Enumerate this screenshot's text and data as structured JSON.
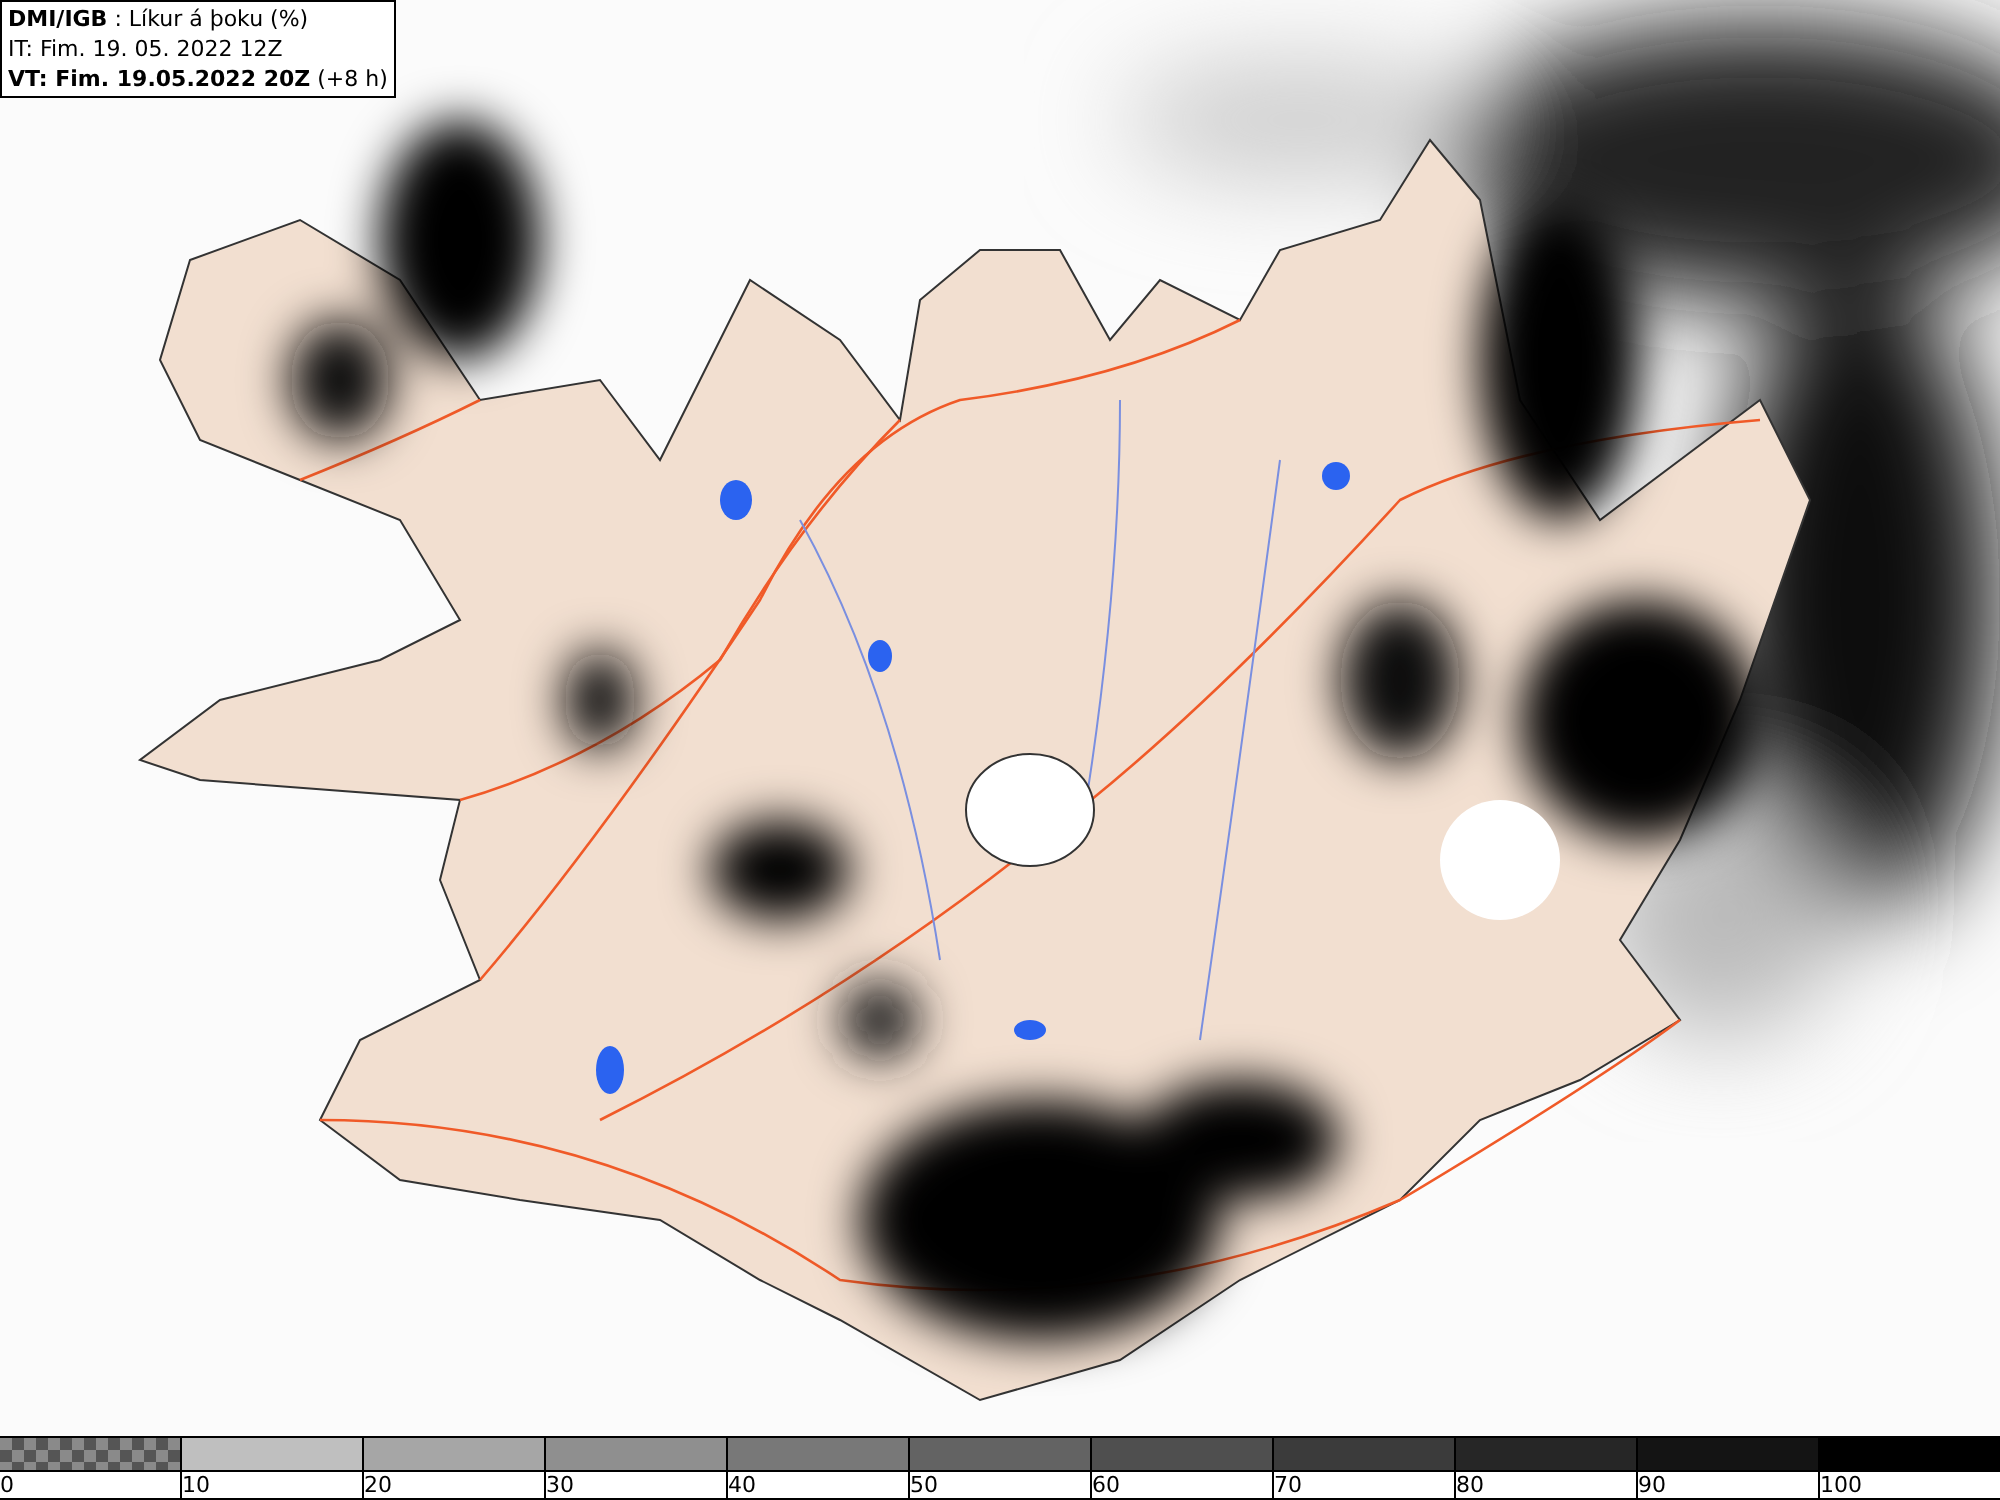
{
  "header": {
    "title": "**DMI/IGB** : Líkur á þoku (%)",
    "init_time": "IT: Fim. 19. 05. 2022 12Z",
    "valid_time": "**VT: Fim. 19.05.2022 20Z** (+8 h)"
  },
  "legend": [
    {
      "kind": "pattern",
      "label": "0"
    },
    {
      "kind": "solid",
      "color": "#bfbfbf",
      "label": "10"
    },
    {
      "kind": "solid",
      "color": "#a6a6a6",
      "label": "20"
    },
    {
      "kind": "solid",
      "color": "#8f8f8f",
      "label": "30"
    },
    {
      "kind": "solid",
      "color": "#787878",
      "label": "40"
    },
    {
      "kind": "solid",
      "color": "#636363",
      "label": "50"
    },
    {
      "kind": "solid",
      "color": "#4f4f4f",
      "label": "60"
    },
    {
      "kind": "solid",
      "color": "#3b3b3b",
      "label": "70"
    },
    {
      "kind": "solid",
      "color": "#262626",
      "label": "80"
    },
    {
      "kind": "solid",
      "color": "#141414",
      "label": "90"
    },
    {
      "kind": "solid",
      "color": "#000000",
      "label": "100"
    }
  ]
}
